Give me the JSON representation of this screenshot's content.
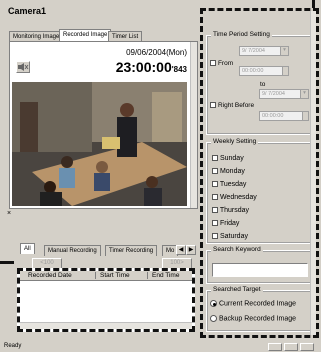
{
  "camera": {
    "title": "Camera1"
  },
  "tabs": [
    {
      "label": "Monitoring Image"
    },
    {
      "label": "Recorded Image"
    },
    {
      "label": "Timer List"
    }
  ],
  "image": {
    "date": "09/06/2004(Mon)",
    "time_main": "23:00:00",
    "time_ms": "843",
    "description": "Office meeting scene"
  },
  "list_tabs": [
    {
      "label": "All"
    },
    {
      "label": "Manual Recording"
    },
    {
      "label": "Timer Recording"
    },
    {
      "label": "Mo"
    }
  ],
  "paging": {
    "prev": "<100",
    "next": "100>"
  },
  "table": {
    "columns": [
      "Recorded Date",
      "Start Time",
      "End Time"
    ]
  },
  "time_period": {
    "title": "Time Period Setting",
    "from_label": "From",
    "from_date": "9/ 7/2004",
    "from_time": "00:00:00",
    "to_label": "to",
    "to_date": "9/ 7/2004",
    "right_before_label": "Right Before",
    "right_before_time": "00:00:00"
  },
  "weekly": {
    "title": "Weekly Setting",
    "days": [
      "Sunday",
      "Monday",
      "Tuesday",
      "Wednesday",
      "Thursday",
      "Friday",
      "Saturday"
    ]
  },
  "search_keyword": {
    "title": "Search Keyword",
    "value": ""
  },
  "searched_target": {
    "title": "Searched Target",
    "options": [
      {
        "label": "Current Recorded Image",
        "selected": true
      },
      {
        "label": "Backup Recorded Image",
        "selected": false
      }
    ]
  },
  "status": {
    "text": "Ready"
  }
}
